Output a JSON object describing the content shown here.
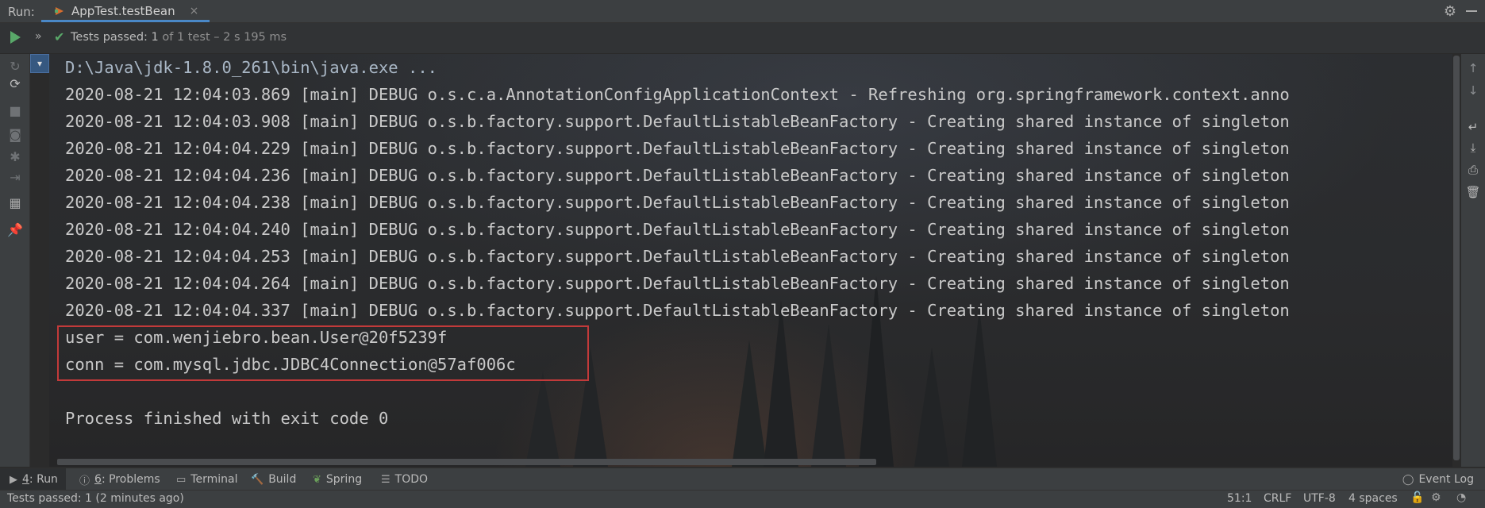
{
  "header": {
    "run_label": "Run:",
    "tab_label": "AppTest.testBean",
    "close_glyph": "×",
    "gear_icon": "gear-icon",
    "minimize_icon": "minimize-icon"
  },
  "test_status": {
    "passed_label": "Tests passed: 1",
    "detail": " of 1 test – 2 s 195 ms"
  },
  "console": {
    "lines": [
      "D:\\Java\\jdk-1.8.0_261\\bin\\java.exe ...",
      "2020-08-21 12:04:03.869 [main] DEBUG o.s.c.a.AnnotationConfigApplicationContext - Refreshing org.springframework.context.anno",
      "2020-08-21 12:04:03.908 [main] DEBUG o.s.b.factory.support.DefaultListableBeanFactory - Creating shared instance of singleton",
      "2020-08-21 12:04:04.229 [main] DEBUG o.s.b.factory.support.DefaultListableBeanFactory - Creating shared instance of singleton",
      "2020-08-21 12:04:04.236 [main] DEBUG o.s.b.factory.support.DefaultListableBeanFactory - Creating shared instance of singleton",
      "2020-08-21 12:04:04.238 [main] DEBUG o.s.b.factory.support.DefaultListableBeanFactory - Creating shared instance of singleton",
      "2020-08-21 12:04:04.240 [main] DEBUG o.s.b.factory.support.DefaultListableBeanFactory - Creating shared instance of singleton",
      "2020-08-21 12:04:04.253 [main] DEBUG o.s.b.factory.support.DefaultListableBeanFactory - Creating shared instance of singleton",
      "2020-08-21 12:04:04.264 [main] DEBUG o.s.b.factory.support.DefaultListableBeanFactory - Creating shared instance of singleton",
      "2020-08-21 12:04:04.337 [main] DEBUG o.s.b.factory.support.DefaultListableBeanFactory - Creating shared instance of singleton",
      "user = com.wenjiebro.bean.User@20f5239f",
      "conn = com.mysql.jdbc.JDBC4Connection@57af006c",
      "",
      "Process finished with exit code 0"
    ]
  },
  "bottom_tabs": [
    {
      "num": "4",
      "label": ": Run",
      "icon": "play-icon"
    },
    {
      "num": "6",
      "label": ": Problems",
      "icon": "info-icon"
    },
    {
      "num": "",
      "label": "Terminal",
      "icon": "terminal-icon"
    },
    {
      "num": "",
      "label": "Build",
      "icon": "hammer-icon"
    },
    {
      "num": "",
      "label": "Spring",
      "icon": "leaf-icon"
    },
    {
      "num": "",
      "label": "TODO",
      "icon": "list-icon"
    }
  ],
  "event_log": "Event Log",
  "statusbar": {
    "message": "Tests passed: 1 (2 minutes ago)",
    "position": "51:1",
    "line_sep": "CRLF",
    "encoding": "UTF-8",
    "indent": "4 spaces"
  },
  "colors": {
    "accent": "#4a88c7",
    "pass_green": "#59a869",
    "highlight_red": "#c23a3a"
  }
}
